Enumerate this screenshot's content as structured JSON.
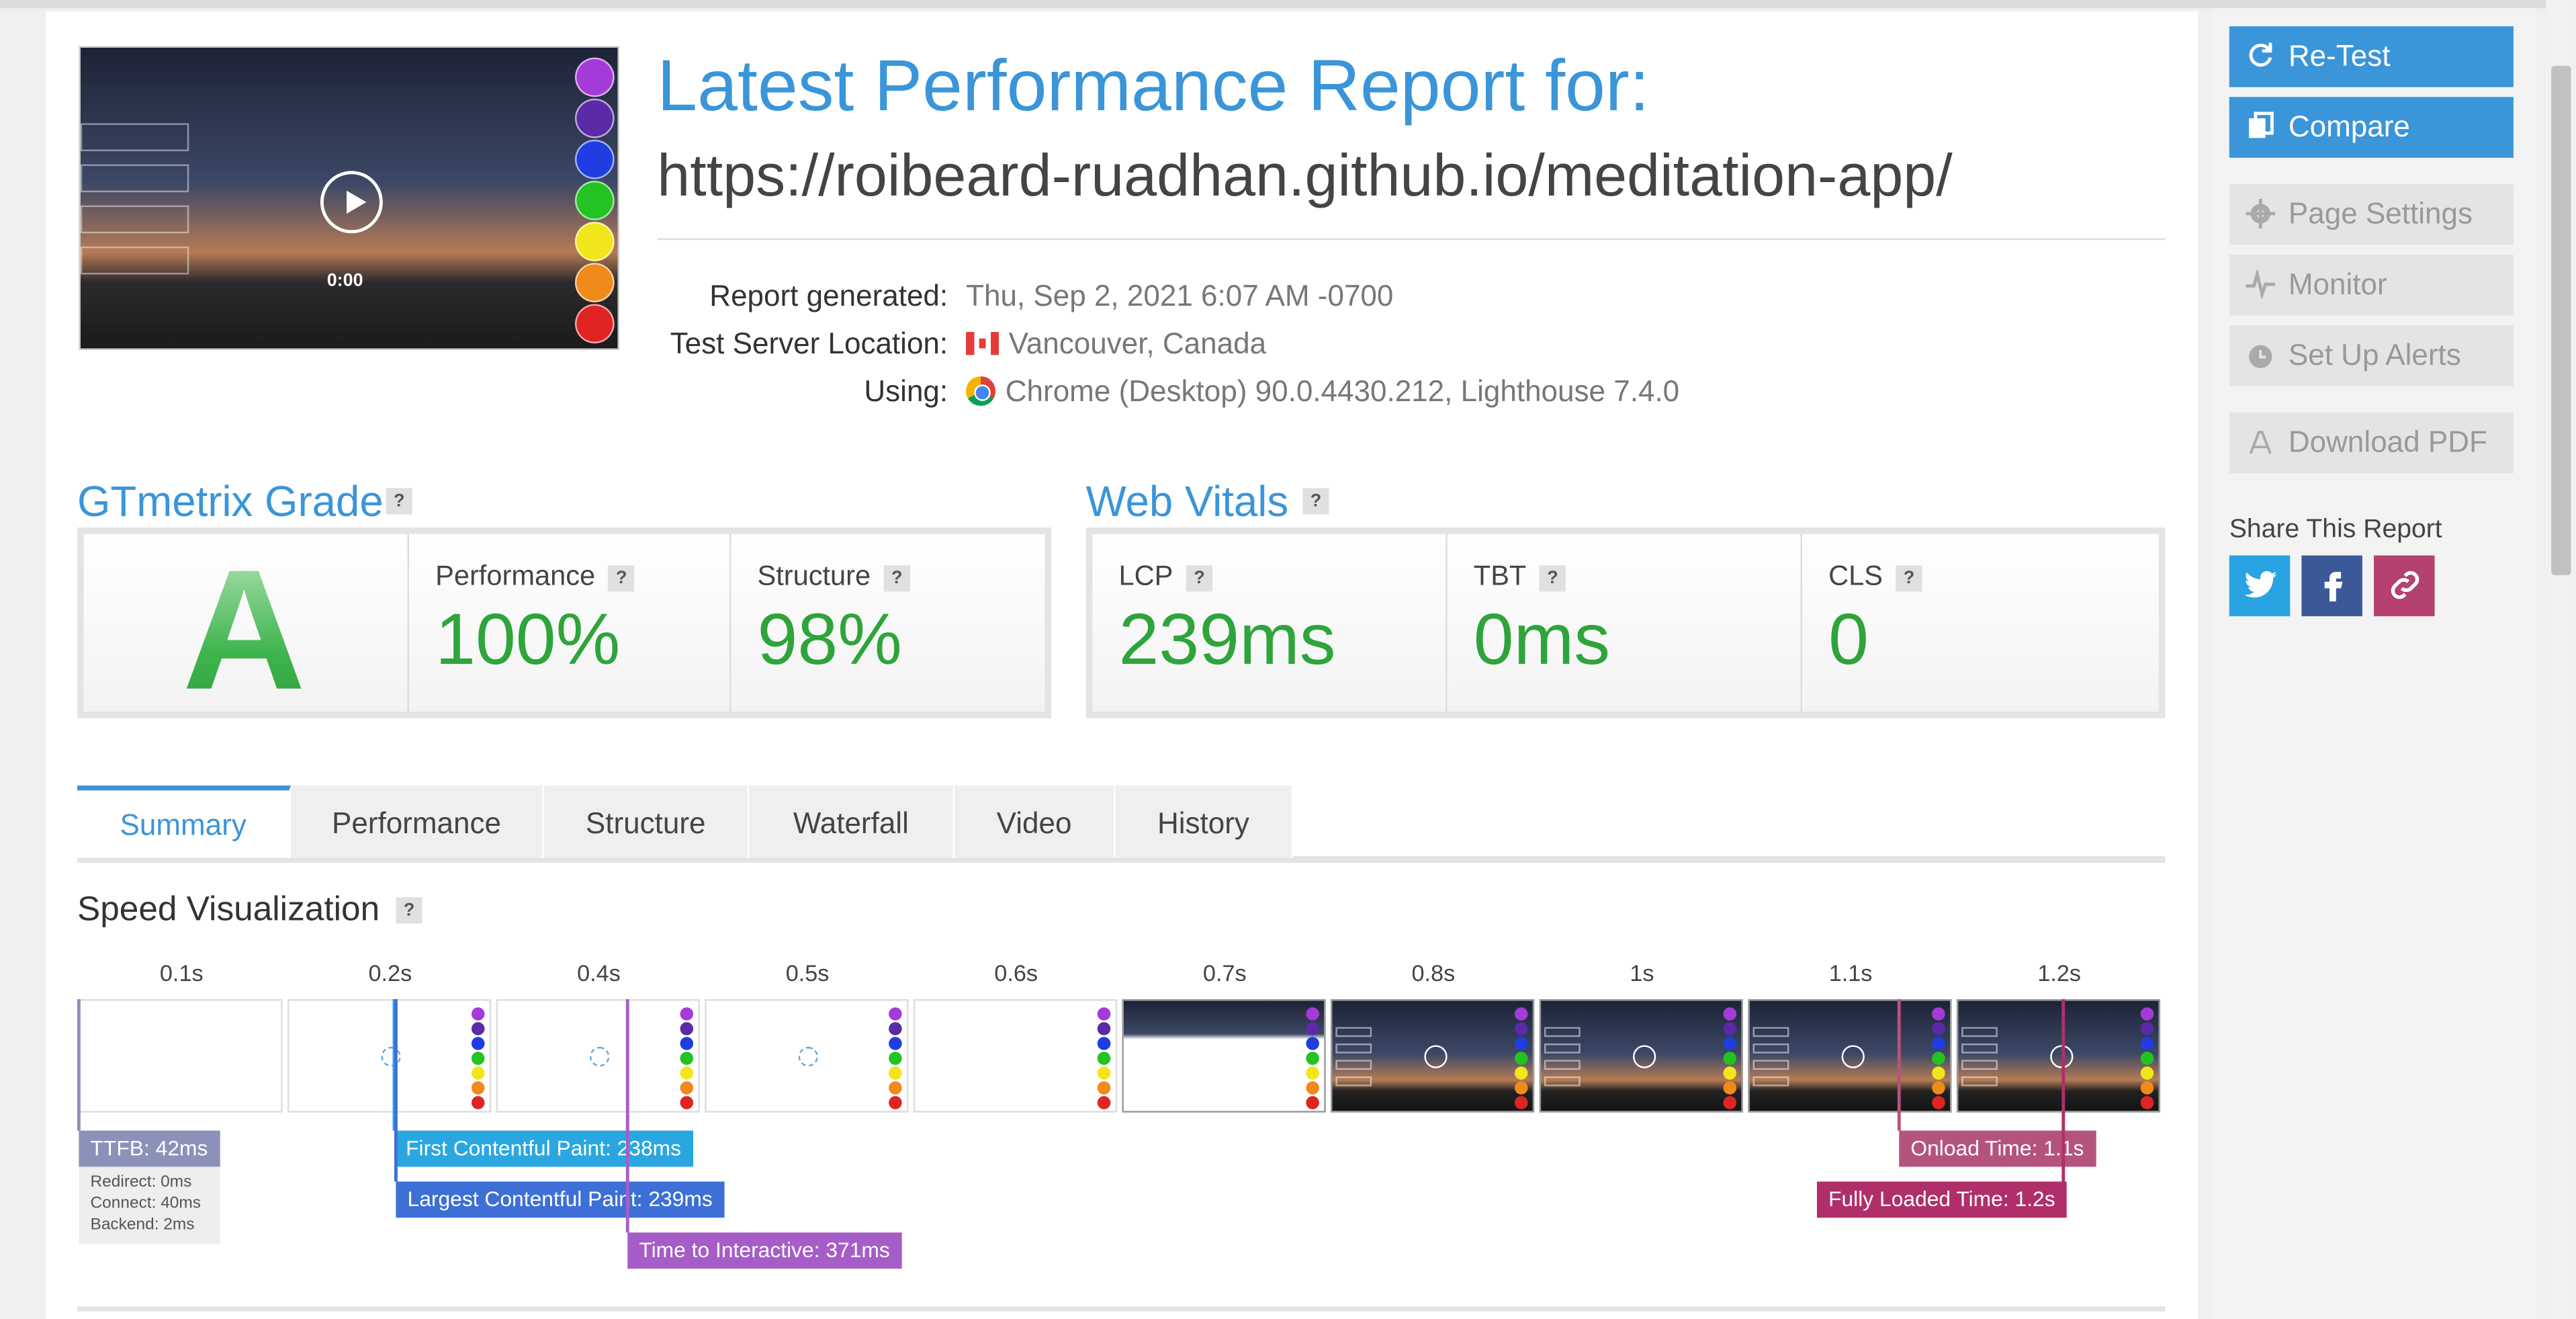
{
  "report": {
    "title": "Latest Performance Report for:",
    "url": "https://roibeard-ruadhan.github.io/meditation-app/",
    "meta": [
      {
        "label": "Report generated:",
        "value": "Thu, Sep 2, 2021 6:07 AM -0700"
      },
      {
        "label": "Test Server Location:",
        "value": "Vancouver, Canada"
      },
      {
        "label": "Using:",
        "value": "Chrome (Desktop) 90.0.4430.212, Lighthouse 7.4.0"
      }
    ]
  },
  "thumbnail": {
    "time": "0:00"
  },
  "grade": {
    "title": "GTmetrix Grade",
    "help": "?",
    "letter": "A",
    "metrics": [
      {
        "label": "Performance",
        "value": "100%"
      },
      {
        "label": "Structure",
        "value": "98%"
      }
    ]
  },
  "vitals": {
    "title": "Web Vitals",
    "help": "?",
    "metrics": [
      {
        "label": "LCP",
        "value": "239ms"
      },
      {
        "label": "TBT",
        "value": "0ms"
      },
      {
        "label": "CLS",
        "value": "0"
      }
    ]
  },
  "tabs": [
    "Summary",
    "Performance",
    "Structure",
    "Waterfall",
    "Video",
    "History"
  ],
  "speed": {
    "title": "Speed Visualization",
    "help": "?",
    "times": [
      "0.1s",
      "0.2s",
      "0.4s",
      "0.5s",
      "0.6s",
      "0.7s",
      "0.8s",
      "1s",
      "1.1s",
      "1.2s"
    ],
    "ttfb": {
      "label": "TTFB: 42ms",
      "details": [
        "Redirect: 0ms",
        "Connect: 40ms",
        "Backend: 2ms"
      ]
    },
    "fcp": "First Contentful Paint: 238ms",
    "lcp": "Largest Contentful Paint: 239ms",
    "tti": "Time to Interactive: 371ms",
    "onload": "Onload Time: 1.1s",
    "fully_loaded": "Fully Loaded Time: 1.2s"
  },
  "sidebar": {
    "retest": "Re-Test",
    "compare": "Compare",
    "page_settings": "Page Settings",
    "monitor": "Monitor",
    "alerts": "Set Up Alerts",
    "download": "Download PDF",
    "share_title": "Share This Report"
  },
  "colors": {
    "accent": "#3a95d9",
    "grade_green": "#2ea43a",
    "ttfb": "#8b91b8",
    "fcp": "#2aa7e0",
    "lcp": "#3d6fd6",
    "tti": "#a65dc8",
    "onload": "#b4547d",
    "fully_loaded": "#b02f6a"
  }
}
